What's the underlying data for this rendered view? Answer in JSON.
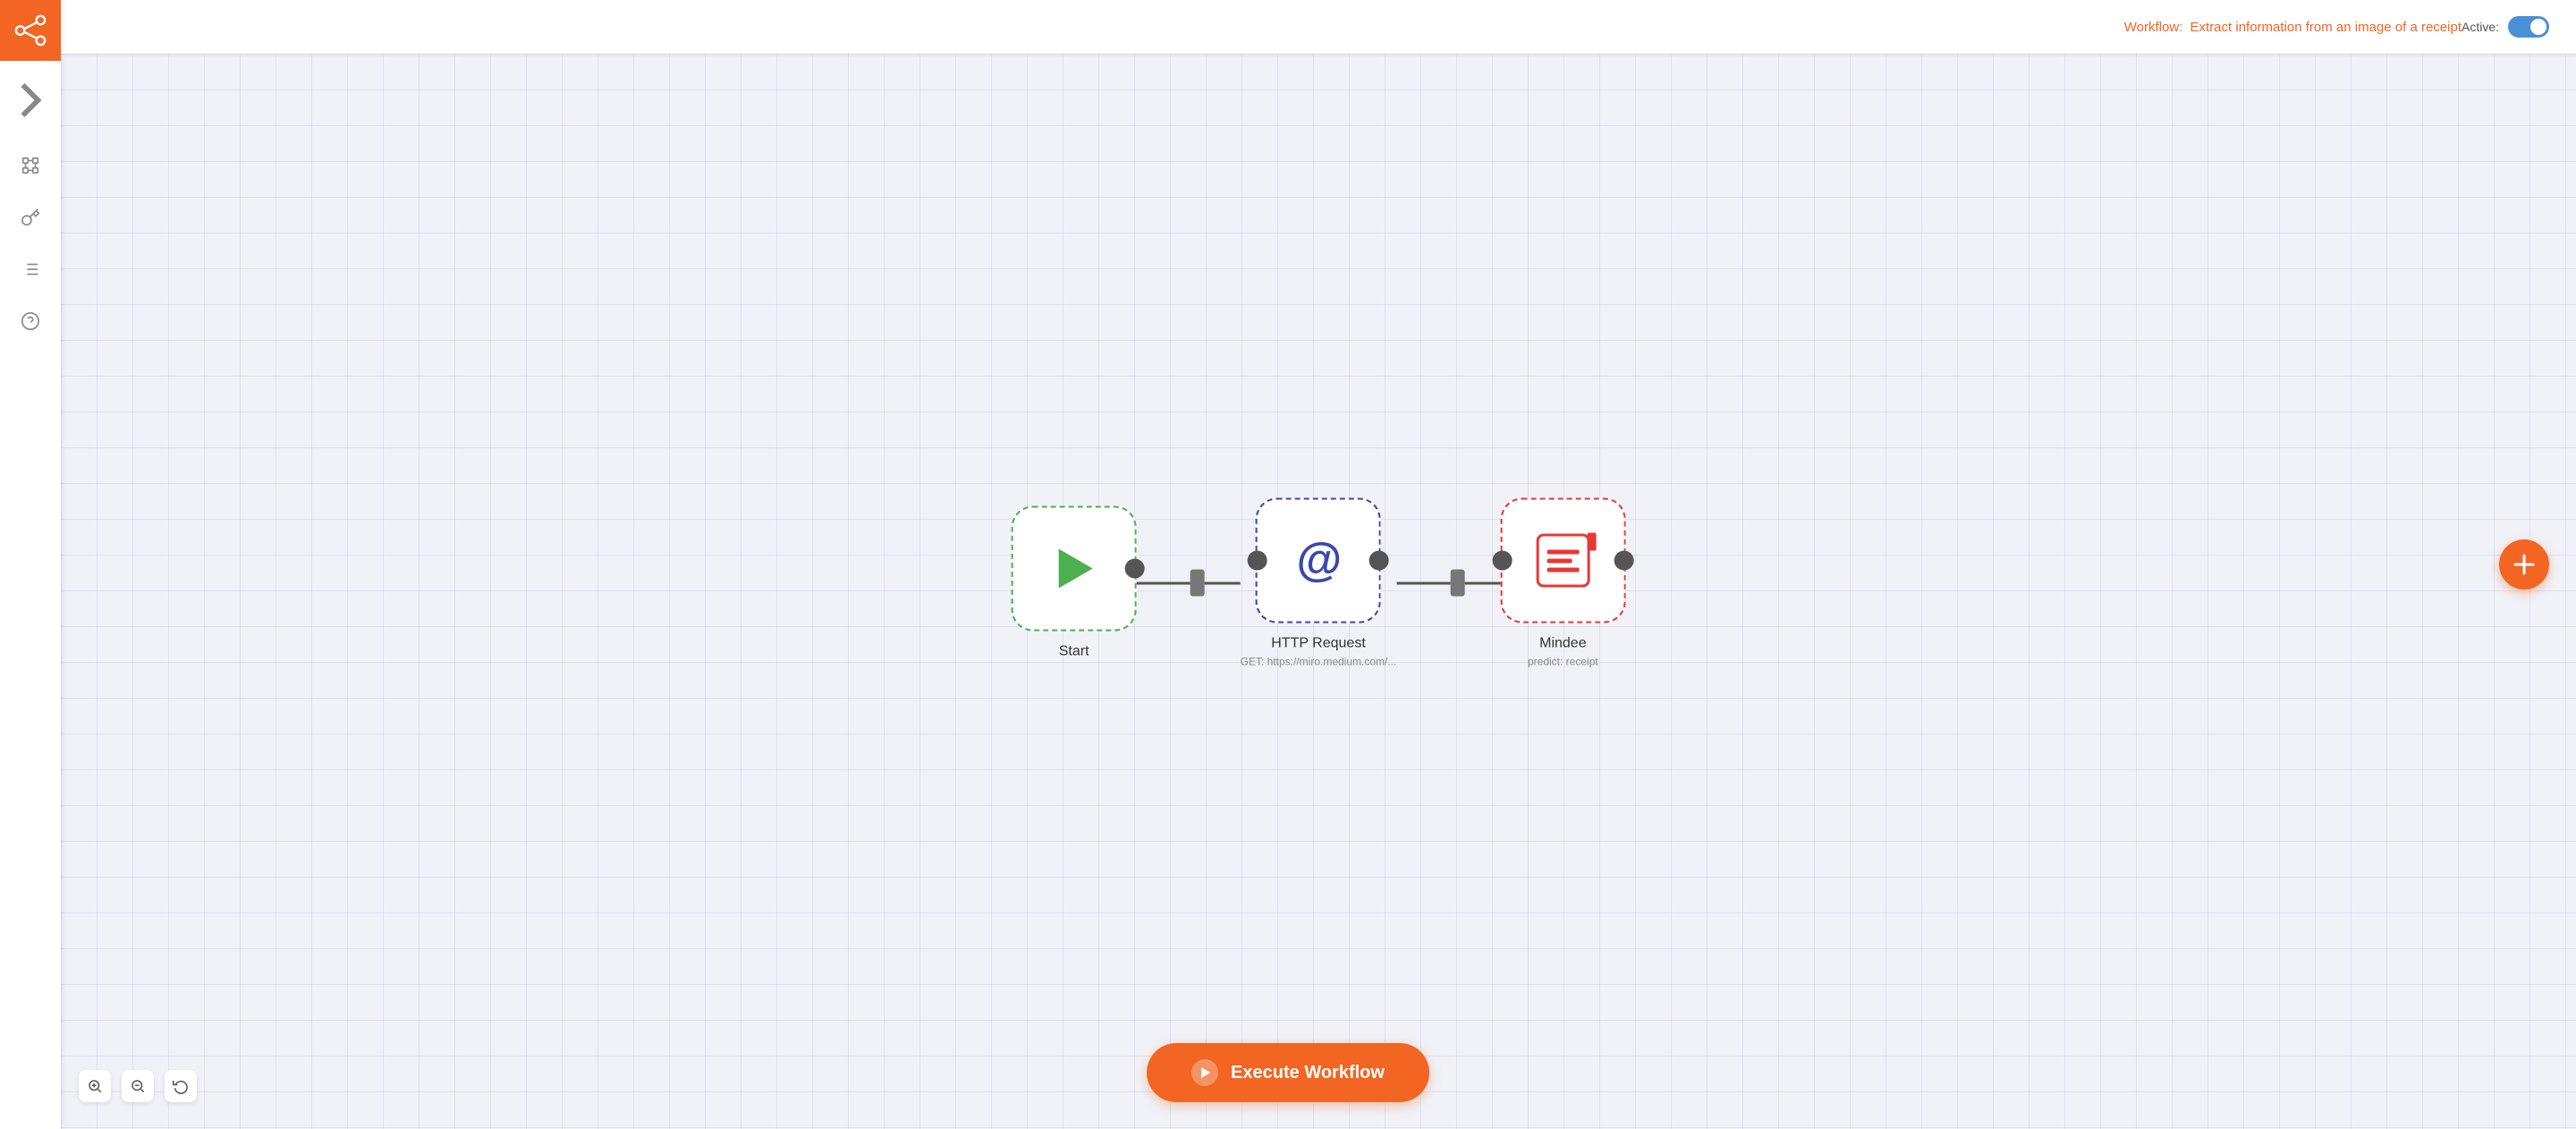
{
  "header": {
    "workflow_prefix": "Workflow:",
    "workflow_name": "Extract information from an image of a receipt",
    "active_label": "Active:"
  },
  "sidebar": {
    "logo_alt": "n8n logo",
    "items": [
      {
        "id": "expand",
        "icon": "chevron-right",
        "label": "Expand sidebar"
      },
      {
        "id": "connections",
        "icon": "network",
        "label": "Connections"
      },
      {
        "id": "credentials",
        "icon": "key",
        "label": "Credentials"
      },
      {
        "id": "executions",
        "icon": "list",
        "label": "Executions"
      },
      {
        "id": "help",
        "icon": "question",
        "label": "Help"
      }
    ]
  },
  "workflow": {
    "nodes": [
      {
        "id": "start",
        "type": "start",
        "label": "Start",
        "sublabel": "",
        "border_color": "#4CAF50"
      },
      {
        "id": "http",
        "type": "http",
        "label": "HTTP Request",
        "sublabel": "GET: https://miro.medium.com/...",
        "border_color": "#3949AB"
      },
      {
        "id": "mindee",
        "type": "mindee",
        "label": "Mindee",
        "sublabel": "predict: receipt",
        "border_color": "#e53935"
      }
    ]
  },
  "controls": {
    "zoom_in_title": "Zoom in",
    "zoom_out_title": "Zoom out",
    "reset_title": "Reset zoom",
    "execute_label": "Execute Workflow"
  },
  "toggle": {
    "active": true
  }
}
